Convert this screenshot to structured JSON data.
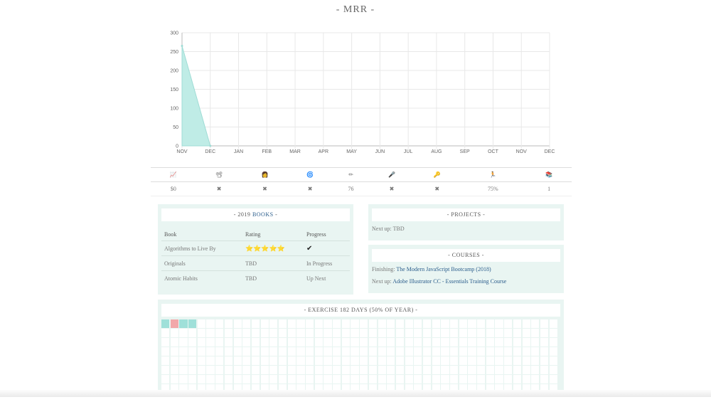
{
  "page_title": "- MRR -",
  "chart_data": {
    "type": "area",
    "categories": [
      "NOV",
      "DEC",
      "JAN",
      "FEB",
      "MAR",
      "APR",
      "MAY",
      "JUN",
      "JUL",
      "AUG",
      "SEP",
      "OCT",
      "NOV",
      "DEC"
    ],
    "series": [
      {
        "values": [
          265,
          0
        ]
      }
    ],
    "ylim": [
      0,
      300
    ],
    "yticks": [
      0,
      50,
      100,
      150,
      200,
      250,
      300
    ],
    "grid": true,
    "fill_color": "#bfece6",
    "line_color": "#9fdcd5"
  },
  "stats": {
    "icons": [
      {
        "name": "chart-icon",
        "glyph": "📈"
      },
      {
        "name": "video-camera-icon",
        "glyph": "📽"
      },
      {
        "name": "person-icon",
        "glyph": "👩"
      },
      {
        "name": "globe-icon",
        "glyph": "🌀"
      },
      {
        "name": "pencil-icon",
        "glyph": "✏"
      },
      {
        "name": "microphone-icon",
        "glyph": "🎤"
      },
      {
        "name": "key-icon",
        "glyph": "🔑"
      },
      {
        "name": "runner-icon",
        "glyph": "🏃"
      },
      {
        "name": "books-icon",
        "glyph": "📚"
      }
    ],
    "values": [
      "$0",
      "✖",
      "✖",
      "✖",
      "76",
      "✖",
      "✖",
      "75%",
      "1"
    ]
  },
  "books": {
    "title_prefix": "- 2019 ",
    "title_accent": "BOOKS",
    "title_suffix": " -",
    "headers": [
      "Book",
      "Rating",
      "Progress"
    ],
    "rows": [
      {
        "book": "Algorithms to Live By",
        "rating": "⭐⭐⭐⭐⭐",
        "progress": "✔"
      },
      {
        "book": "Originals",
        "rating": "TBD",
        "progress": "In Progress"
      },
      {
        "book": "Atomic Habits",
        "rating": "TBD",
        "progress": "Up Next"
      }
    ]
  },
  "projects": {
    "title": "- PROJECTS -",
    "next_label": "Next up: TBD"
  },
  "courses": {
    "title": "- COURSES -",
    "finishing_label": "Finishing: ",
    "finishing_link": "The Modern JavaScript Bootcamp (2018)",
    "next_label": "Next up: ",
    "next_link": "Adobe Illustrator CC - Essentials Training Course"
  },
  "exercise": {
    "title": "- EXERCISE 182 DAYS (50% OF YEAR) -",
    "total_days": 365,
    "day_status": [
      "done",
      "miss",
      "done",
      "done"
    ]
  }
}
